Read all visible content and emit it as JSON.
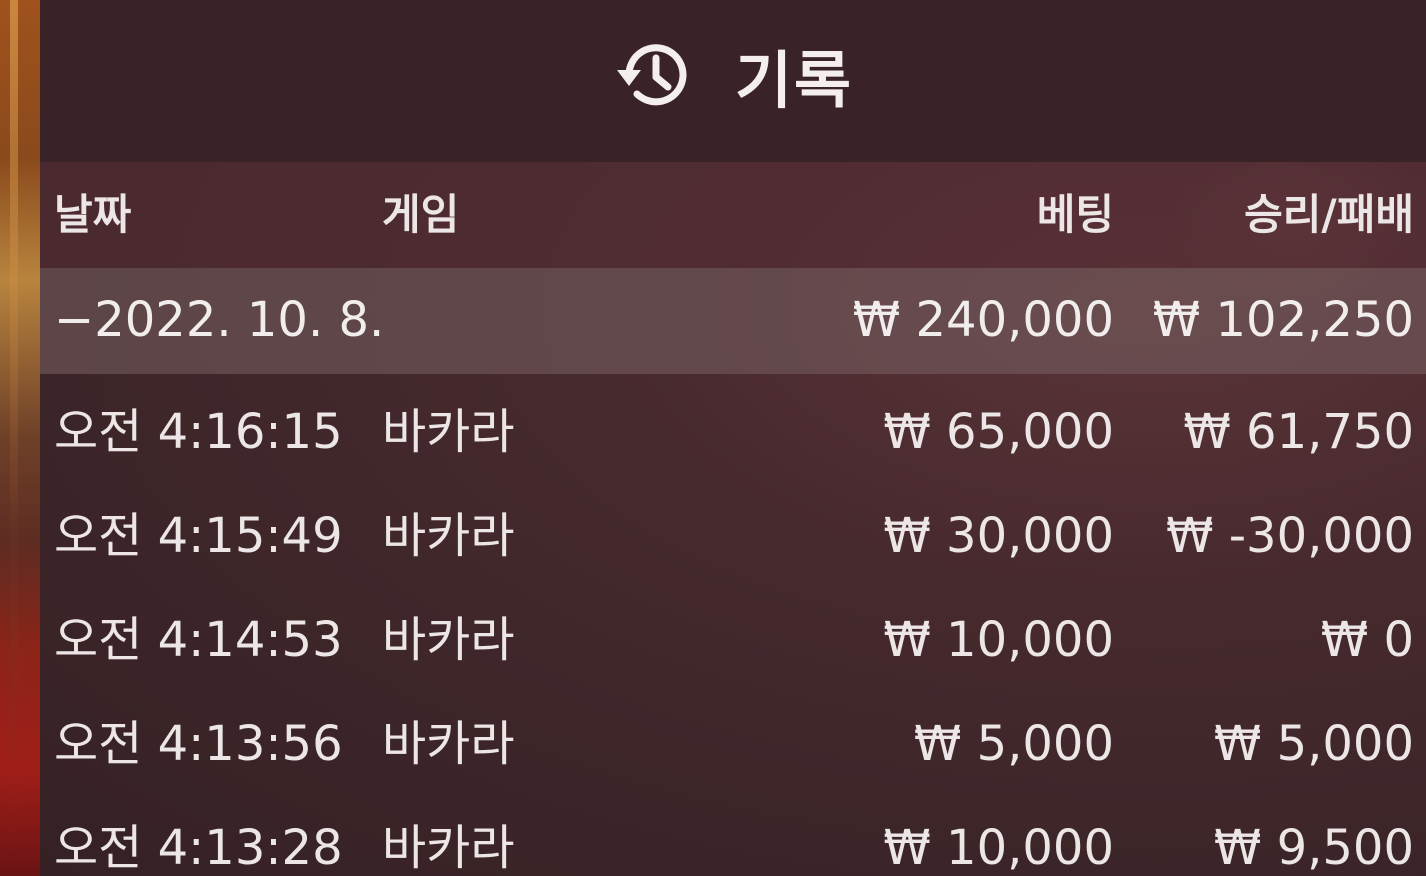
{
  "header": {
    "title": "기록"
  },
  "columns": {
    "date": "날짜",
    "game": "게임",
    "bet": "베팅",
    "win_loss": "승리/패배"
  },
  "date_group": {
    "date": "−2022. 10. 8.",
    "total_bet": "₩ 240,000",
    "total_win_loss": "₩ 102,250"
  },
  "rows": [
    {
      "time": "오전 4:16:15",
      "game": "바카라",
      "bet": "₩ 65,000",
      "win_loss": "₩ 61,750"
    },
    {
      "time": "오전 4:15:49",
      "game": "바카라",
      "bet": "₩ 30,000",
      "win_loss": "₩ -30,000"
    },
    {
      "time": "오전 4:14:53",
      "game": "바카라",
      "bet": "₩ 10,000",
      "win_loss": "₩ 0"
    },
    {
      "time": "오전 4:13:56",
      "game": "바카라",
      "bet": "₩ 5,000",
      "win_loss": "₩ 5,000"
    },
    {
      "time": "오전 4:13:28",
      "game": "바카라",
      "bet": "₩ 10,000",
      "win_loss": "₩ 9,500"
    }
  ],
  "icons": {
    "title_icon": "history-icon"
  },
  "colors": {
    "panel_bg": "#3c2528",
    "header_bg": "#562e34",
    "date_row_bg": "#786062",
    "text": "#ece6e6"
  }
}
